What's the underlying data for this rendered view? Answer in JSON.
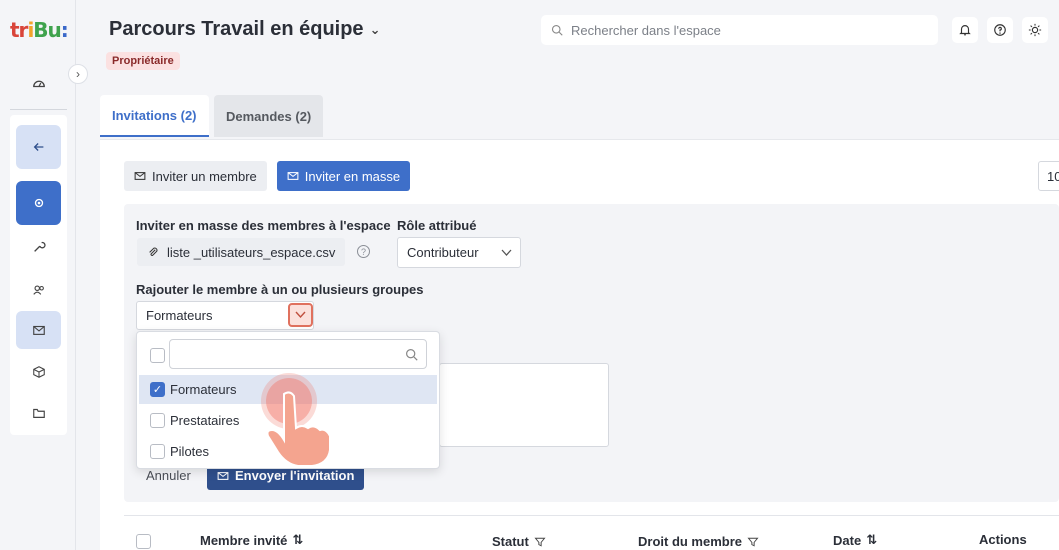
{
  "app": {
    "logo_parts": [
      "tr",
      "i",
      "Bu",
      ":"
    ]
  },
  "header": {
    "title": "Parcours Travail en équipe",
    "role_badge": "Propriétaire",
    "search_placeholder": "Rechercher dans l'espace"
  },
  "tabs": [
    {
      "label": "Invitations (2)",
      "active": true
    },
    {
      "label": "Demandes (2)",
      "active": false
    }
  ],
  "toolbar": {
    "invite_member": "Inviter un membre",
    "invite_bulk": "Inviter en masse",
    "page_size": "10"
  },
  "bulk_form": {
    "bulk_label": "Inviter en masse des membres à l'espace",
    "file_name": "liste _utilisateurs_espace.csv",
    "role_label": "Rôle attribué",
    "role_value": "Contributeur",
    "groups_label": "Rajouter le membre à un ou plusieurs groupes",
    "groups_value": "Formateurs",
    "cancel": "Annuler",
    "send": "Envoyer l'invitation"
  },
  "groups_dropdown": {
    "search_placeholder": "",
    "options": [
      {
        "label": "Formateurs",
        "checked": true
      },
      {
        "label": "Prestataires",
        "checked": false
      },
      {
        "label": "Pilotes",
        "checked": false
      }
    ]
  },
  "table": {
    "columns": [
      "Membre invité",
      "Statut",
      "Droit du membre",
      "Date",
      "Actions"
    ]
  },
  "colors": {
    "accent": "#3e6fc9",
    "badge_bg": "#fbe1e1",
    "highlight": "#e0715e"
  }
}
